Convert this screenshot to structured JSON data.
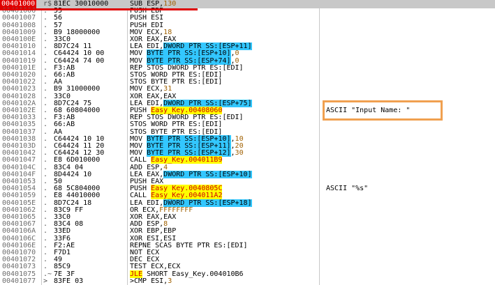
{
  "colors": {
    "selection_address_bg": "#e00000",
    "selection_row_bg": "#c8c8c8",
    "operand_highlight": "#33c7ff",
    "call_jump_highlight": "#ffff00",
    "annotation_box": "#f0a050"
  },
  "rows": [
    {
      "addr": "00401000",
      "arrow": "r$",
      "hex": "81EC 30010000",
      "pre": "SUB ESP,",
      "hl": "",
      "post": "",
      "num": "130",
      "comment": ""
    },
    {
      "addr": "00401006",
      "arrow": ".",
      "hex": "55",
      "pre": "PUSH EBP",
      "hl": "",
      "post": "",
      "num": "",
      "comment": ""
    },
    {
      "addr": "00401007",
      "arrow": ".",
      "hex": "56",
      "pre": "PUSH ESI",
      "hl": "",
      "post": "",
      "num": "",
      "comment": ""
    },
    {
      "addr": "00401008",
      "arrow": ".",
      "hex": "57",
      "pre": "PUSH EDI",
      "hl": "",
      "post": "",
      "num": "",
      "comment": ""
    },
    {
      "addr": "00401009",
      "arrow": ".",
      "hex": "B9 18000000",
      "pre": "MOV ECX,",
      "hl": "",
      "post": "",
      "num": "18",
      "comment": ""
    },
    {
      "addr": "0040100E",
      "arrow": ".",
      "hex": "33C0",
      "pre": "XOR EAX,EAX",
      "hl": "",
      "post": "",
      "num": "",
      "comment": ""
    },
    {
      "addr": "00401010",
      "arrow": ".",
      "hex": "8D7C24 11",
      "pre": "LEA EDI,",
      "hl": "DWORD PTR SS:[ESP+11]",
      "post": "",
      "num": "",
      "comment": ""
    },
    {
      "addr": "00401014",
      "arrow": ".",
      "hex": "C64424 10 00",
      "pre": "MOV ",
      "hl": "BYTE PTR SS:[ESP+10]",
      "post": ",",
      "num": "0",
      "comment": ""
    },
    {
      "addr": "00401019",
      "arrow": ".",
      "hex": "C64424 74 00",
      "pre": "MOV ",
      "hl": "BYTE PTR SS:[ESP+74]",
      "post": ",",
      "num": "0",
      "comment": ""
    },
    {
      "addr": "0040101E",
      "arrow": ".",
      "hex": "F3:AB",
      "pre": "REP STOS DWORD PTR ES:[EDI]",
      "hl": "",
      "post": "",
      "num": "",
      "comment": ""
    },
    {
      "addr": "00401020",
      "arrow": ".",
      "hex": "66:AB",
      "pre": "STOS WORD PTR ES:[EDI]",
      "hl": "",
      "post": "",
      "num": "",
      "comment": ""
    },
    {
      "addr": "00401022",
      "arrow": ".",
      "hex": "AA",
      "pre": "STOS BYTE PTR ES:[EDI]",
      "hl": "",
      "post": "",
      "num": "",
      "comment": ""
    },
    {
      "addr": "00401023",
      "arrow": ".",
      "hex": "B9 31000000",
      "pre": "MOV ECX,",
      "hl": "",
      "post": "",
      "num": "31",
      "comment": ""
    },
    {
      "addr": "00401028",
      "arrow": ".",
      "hex": "33C0",
      "pre": "XOR EAX,EAX",
      "hl": "",
      "post": "",
      "num": "",
      "comment": ""
    },
    {
      "addr": "0040102A",
      "arrow": ".",
      "hex": "8D7C24 75",
      "pre": "LEA EDI,",
      "hl": "DWORD PTR SS:[ESP+75]",
      "post": "",
      "num": "",
      "comment": ""
    },
    {
      "addr": "0040102E",
      "arrow": ".",
      "hex": "68 60804000",
      "pre": "PUSH ",
      "hl": "",
      "post": "",
      "num": "",
      "yellow": "Easy_Key.00408060",
      "comment": "ASCII \"Input Name: \""
    },
    {
      "addr": "00401033",
      "arrow": ".",
      "hex": "F3:AB",
      "pre": "REP STOS DWORD PTR ES:[EDI]",
      "hl": "",
      "post": "",
      "num": "",
      "comment": ""
    },
    {
      "addr": "00401035",
      "arrow": ".",
      "hex": "66:AB",
      "pre": "STOS WORD PTR ES:[EDI]",
      "hl": "",
      "post": "",
      "num": "",
      "comment": ""
    },
    {
      "addr": "00401037",
      "arrow": ".",
      "hex": "AA",
      "pre": "STOS BYTE PTR ES:[EDI]",
      "hl": "",
      "post": "",
      "num": "",
      "comment": ""
    },
    {
      "addr": "00401038",
      "arrow": ".",
      "hex": "C64424 10 10",
      "pre": "MOV ",
      "hl": "BYTE PTR SS:[ESP+10]",
      "post": ",",
      "num": "10",
      "comment": ""
    },
    {
      "addr": "0040103D",
      "arrow": ".",
      "hex": "C64424 11 20",
      "pre": "MOV ",
      "hl": "BYTE PTR SS:[ESP+11]",
      "post": ",",
      "num": "20",
      "comment": ""
    },
    {
      "addr": "00401042",
      "arrow": ".",
      "hex": "C64424 12 30",
      "pre": "MOV ",
      "hl": "BYTE PTR SS:[ESP+12]",
      "post": ",",
      "num": "30",
      "comment": ""
    },
    {
      "addr": "00401047",
      "arrow": ".",
      "hex": "E8 6D010000",
      "pre": "CALL ",
      "hl": "",
      "post": "",
      "num": "",
      "yellow": "Easy_Key.004011B9",
      "comment": ""
    },
    {
      "addr": "0040104C",
      "arrow": ".",
      "hex": "83C4 04",
      "pre": "ADD ESP,",
      "hl": "",
      "post": "",
      "num": "4",
      "comment": ""
    },
    {
      "addr": "0040104F",
      "arrow": ".",
      "hex": "8D4424 10",
      "pre": "LEA EAX,",
      "hl": "DWORD PTR SS:[ESP+10]",
      "post": "",
      "num": "",
      "comment": ""
    },
    {
      "addr": "00401053",
      "arrow": ".",
      "hex": "50",
      "pre": "PUSH EAX",
      "hl": "",
      "post": "",
      "num": "",
      "comment": ""
    },
    {
      "addr": "00401054",
      "arrow": ".",
      "hex": "68 5C804000",
      "pre": "PUSH ",
      "hl": "",
      "post": "",
      "num": "",
      "yellow": "Easy_Key.0040805C",
      "comment": "ASCII \"%s\""
    },
    {
      "addr": "00401059",
      "arrow": ".",
      "hex": "E8 44010000",
      "pre": "CALL ",
      "hl": "",
      "post": "",
      "num": "",
      "yellow": "Easy_Key.004011A2",
      "comment": ""
    },
    {
      "addr": "0040105E",
      "arrow": ".",
      "hex": "8D7C24 18",
      "pre": "LEA EDI,",
      "hl": "DWORD PTR SS:[ESP+18]",
      "post": "",
      "num": "",
      "comment": ""
    },
    {
      "addr": "00401062",
      "arrow": ".",
      "hex": "83C9 FF",
      "pre": "OR ECX,",
      "hl": "",
      "post": "",
      "num": "FFFFFFFF",
      "comment": ""
    },
    {
      "addr": "00401065",
      "arrow": ".",
      "hex": "33C0",
      "pre": "XOR EAX,EAX",
      "hl": "",
      "post": "",
      "num": "",
      "comment": ""
    },
    {
      "addr": "00401067",
      "arrow": ".",
      "hex": "83C4 08",
      "pre": "ADD ESP,",
      "hl": "",
      "post": "",
      "num": "8",
      "comment": ""
    },
    {
      "addr": "0040106A",
      "arrow": ".",
      "hex": "33ED",
      "pre": "XOR EBP,EBP",
      "hl": "",
      "post": "",
      "num": "",
      "comment": ""
    },
    {
      "addr": "0040106C",
      "arrow": ".",
      "hex": "33F6",
      "pre": "XOR ESI,ESI",
      "hl": "",
      "post": "",
      "num": "",
      "comment": ""
    },
    {
      "addr": "0040106E",
      "arrow": ".",
      "hex": "F2:AE",
      "pre": "REPNE SCAS BYTE PTR ES:[EDI]",
      "hl": "",
      "post": "",
      "num": "",
      "comment": ""
    },
    {
      "addr": "00401070",
      "arrow": ".",
      "hex": "F7D1",
      "pre": "NOT ECX",
      "hl": "",
      "post": "",
      "num": "",
      "comment": ""
    },
    {
      "addr": "00401072",
      "arrow": ".",
      "hex": "49",
      "pre": "DEC ECX",
      "hl": "",
      "post": "",
      "num": "",
      "comment": ""
    },
    {
      "addr": "00401073",
      "arrow": ".",
      "hex": "85C9",
      "pre": "TEST ECX,ECX",
      "hl": "",
      "post": "",
      "num": "",
      "comment": ""
    },
    {
      "addr": "00401075",
      "arrow": ".~",
      "hex": "7E 3F",
      "pre": "",
      "hl": "",
      "post": "",
      "num": "",
      "yellowjle": "JLE",
      "after_jle": " SHORT Easy_Key.004010B6",
      "comment": ""
    },
    {
      "addr": "00401077",
      "arrow": ">",
      "hex": "83FE 03",
      "pre": ">CMP ESI,",
      "hl": "",
      "post": "",
      "num": "3",
      "comment": ""
    }
  ]
}
